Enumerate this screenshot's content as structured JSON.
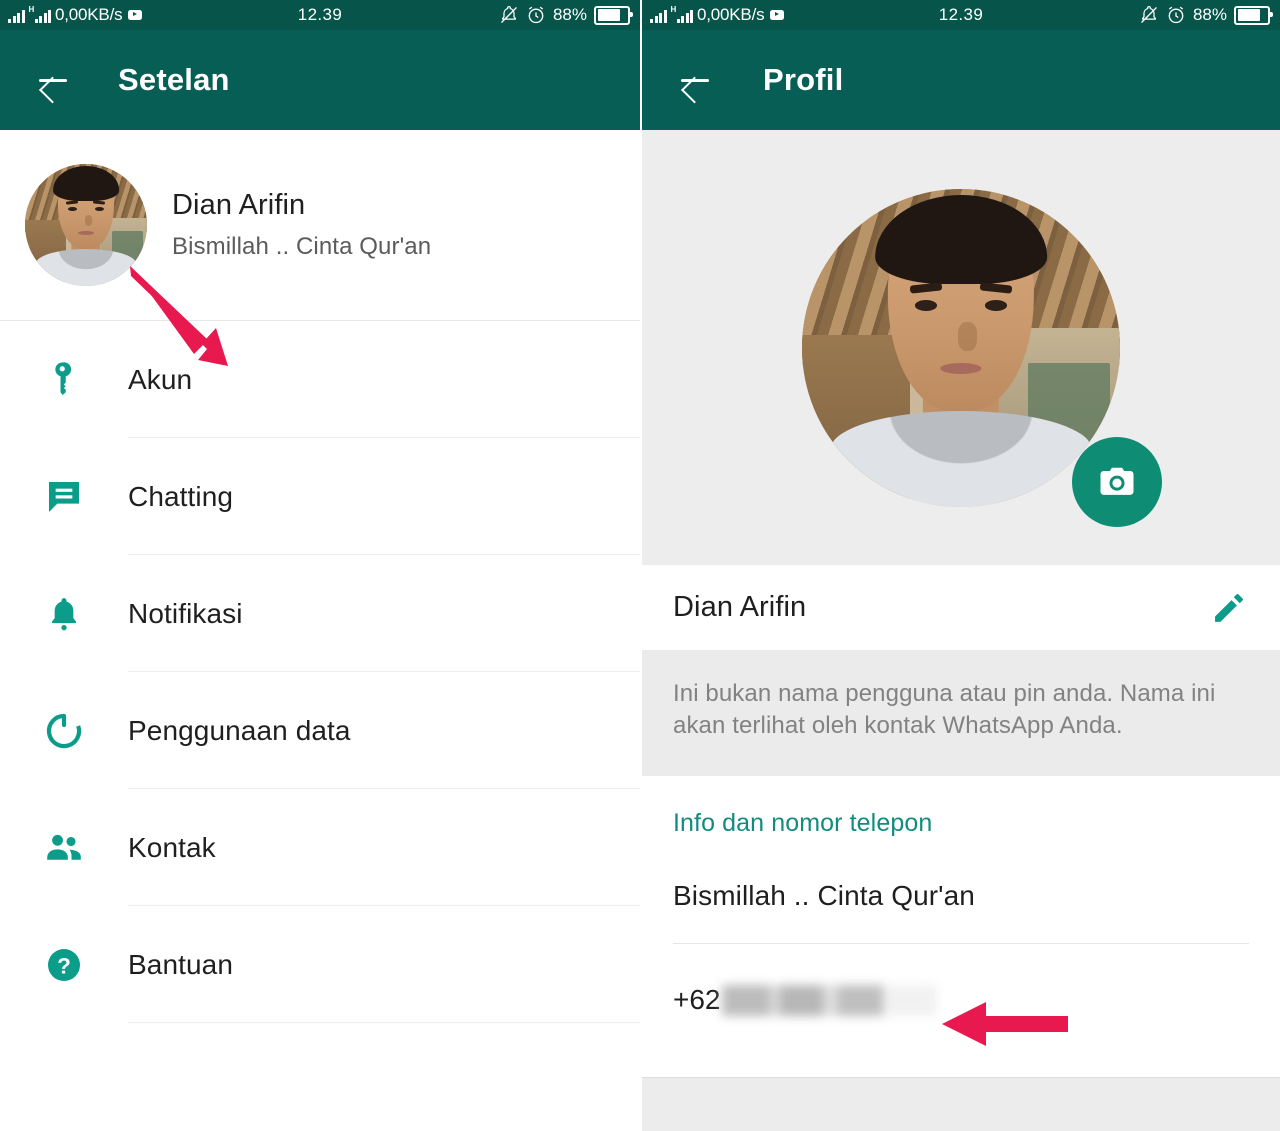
{
  "status_bar": {
    "network_speed": "0,00KB/s",
    "h_label": "H",
    "time": "12.39",
    "battery_percent": "88%",
    "icons": [
      "signal-bars-icon",
      "hspa-signal-icon",
      "youtube-icon",
      "bell-off-icon",
      "alarm-clock-icon",
      "battery-icon"
    ]
  },
  "left_panel": {
    "appbar": {
      "back_label": "←",
      "title": "Setelan"
    },
    "profile": {
      "name": "Dian Arifin",
      "status": "Bismillah .. Cinta Qur'an"
    },
    "menu": [
      {
        "label": "Akun",
        "icon": "key-icon"
      },
      {
        "label": "Chatting",
        "icon": "chat-bubble-icon"
      },
      {
        "label": "Notifikasi",
        "icon": "bell-icon"
      },
      {
        "label": "Penggunaan data",
        "icon": "data-usage-icon"
      },
      {
        "label": "Kontak",
        "icon": "contacts-icon"
      },
      {
        "label": "Bantuan",
        "icon": "help-circle-icon"
      }
    ]
  },
  "right_panel": {
    "appbar": {
      "back_label": "←",
      "title": "Profil"
    },
    "photo": {
      "camera_button_icon": "camera-icon"
    },
    "name_row": {
      "name": "Dian Arifin",
      "edit_icon": "pencil-icon"
    },
    "hint": "Ini bukan nama pengguna atau pin anda. Nama ini akan terlihat oleh kontak WhatsApp Anda.",
    "info_section": {
      "title": "Info dan nomor telepon",
      "about": "Bismillah .. Cinta Qur'an",
      "phone_prefix": "+62",
      "phone_redacted": true
    }
  },
  "annotations": {
    "arrow_left": "pink-arrow-pointing-to-profile-photo",
    "arrow_right": "pink-arrow-pointing-to-phone-number"
  },
  "colors": {
    "status_bar": "#07544B",
    "app_bar": "#075E54",
    "accent_teal": "#0E8D74",
    "link_green": "#128C7E",
    "photo_bg": "#EDEDED",
    "hint_bg": "#EBEBEB",
    "arrow_pink": "#E8194F"
  }
}
